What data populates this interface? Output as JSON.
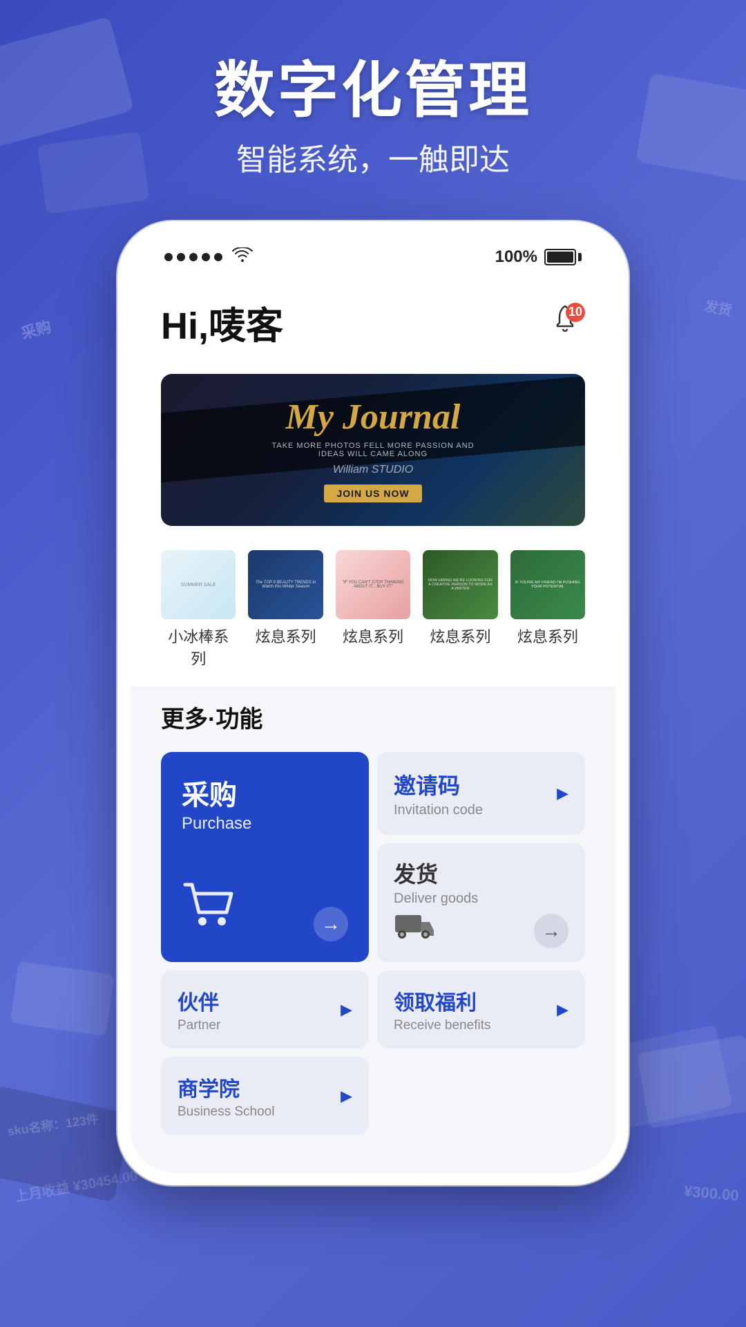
{
  "background": {
    "color": "#4a5bc7"
  },
  "header": {
    "title": "数字化管理",
    "subtitle": "智能系统，一触即达"
  },
  "status_bar": {
    "dots": 5,
    "wifi": true,
    "battery_percent": "100%",
    "battery_full": true
  },
  "app": {
    "greeting": "Hi,唛客",
    "notification_count": "10",
    "banner": {
      "title": "My Journal",
      "subtitle": "TAKE MORE PHOTOS FELL MORE PASSION AND IDEAS WILL CAME ALONG",
      "studio": "William STUDIO",
      "cta": "JOIN US NOW"
    },
    "thumbnails": [
      {
        "label": "小冰棒系列",
        "style": "light-blue"
      },
      {
        "label": "炫息系列",
        "style": "dark-blue"
      },
      {
        "label": "炫息系列",
        "style": "pink"
      },
      {
        "label": "炫息系列",
        "style": "dark-green"
      },
      {
        "label": "炫息系列",
        "style": "green"
      }
    ],
    "more_section_title": "更多·功能",
    "buttons": {
      "purchase": {
        "zh": "采购",
        "en": "Purchase"
      },
      "invitation_code": {
        "zh": "邀请码",
        "en": "Invitation code"
      },
      "deliver_goods": {
        "zh": "发货",
        "en": "Deliver goods"
      },
      "partner": {
        "zh": "伙伴",
        "en": "Partner"
      },
      "business_school": {
        "zh": "商学院",
        "en": "Business School"
      },
      "receive_benefits": {
        "zh": "领取福利",
        "en": "Receive benefits"
      }
    }
  }
}
